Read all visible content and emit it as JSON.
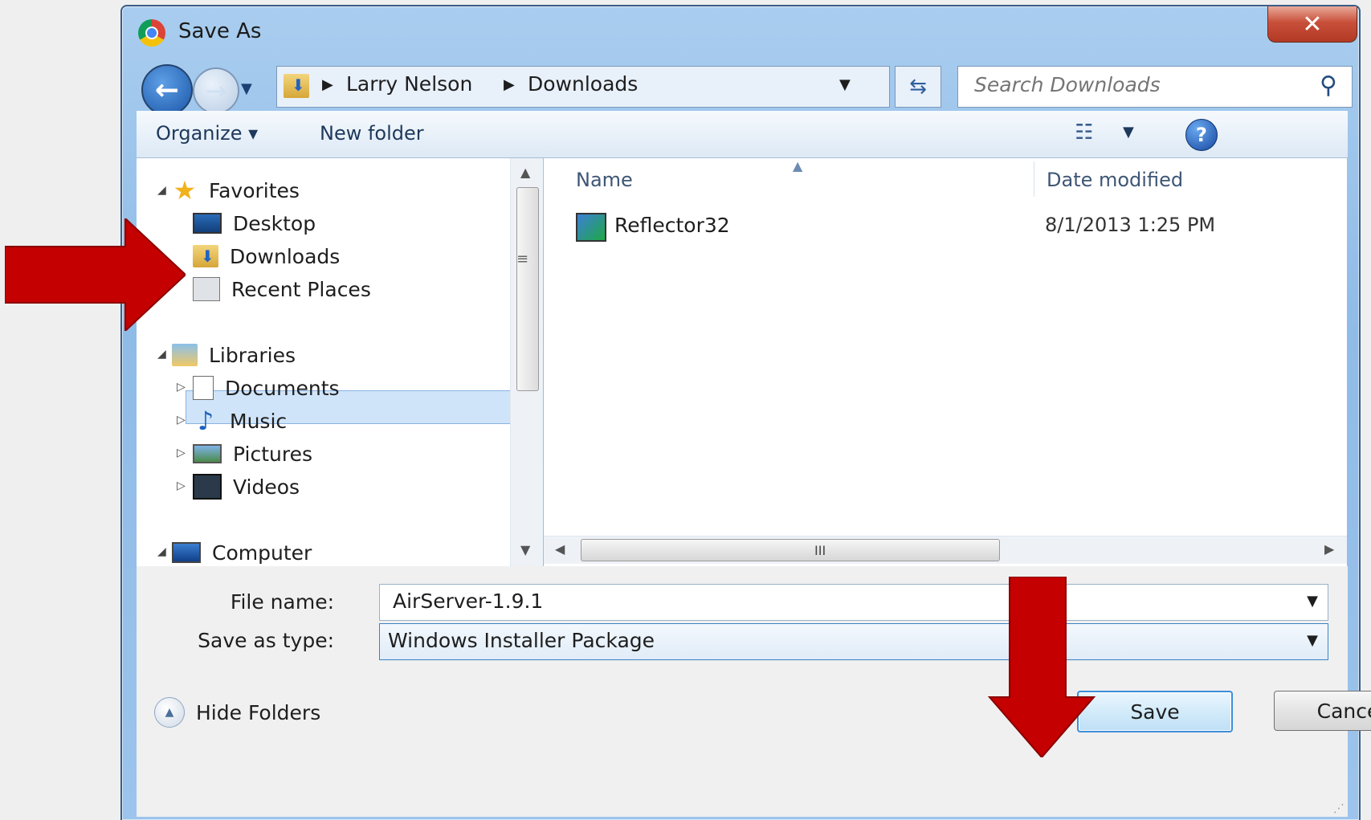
{
  "window": {
    "title": "Save As",
    "close_label": "✕"
  },
  "nav": {
    "back_label": "←",
    "forward_label": "→",
    "history_dropdown": "▼",
    "breadcrumbs": [
      "Larry Nelson",
      "Downloads"
    ],
    "crumb_separator": "▶",
    "address_dropdown": "▼",
    "refresh_label": "⇆",
    "search_placeholder": "Search Downloads",
    "search_icon": "⚲"
  },
  "toolbar": {
    "organize_label": "Organize ▾",
    "new_folder_label": "New folder",
    "view_icon": "☷",
    "view_dropdown": "▼",
    "help_label": "?"
  },
  "sidebar": {
    "favorites": {
      "label": "Favorites",
      "items": [
        "Desktop",
        "Downloads",
        "Recent Places"
      ]
    },
    "libraries": {
      "label": "Libraries",
      "items": [
        "Documents",
        "Music",
        "Pictures",
        "Videos"
      ]
    },
    "computer": {
      "label": "Computer"
    },
    "expanded_toggle": "◢",
    "collapsed_toggle": "▷"
  },
  "file_list": {
    "columns": [
      "Name",
      "Date modified"
    ],
    "sort_indicator": "▲",
    "files": [
      {
        "name": "Reflector32",
        "date_modified": "8/1/2013 1:25 PM"
      }
    ],
    "scroll_grip": "III"
  },
  "form": {
    "filename_label": "File name:",
    "filename_value": "AirServer-1.9.1",
    "type_label": "Save as type:",
    "type_value": "Windows Installer Package",
    "dropdown_glyph": "▼"
  },
  "footer": {
    "hide_folders_label": "Hide Folders",
    "save_label": "Save",
    "cancel_label": "Cancel"
  },
  "colors": {
    "annotation_arrow": "#c40000",
    "frame": "#9cc4ec",
    "selection": "#cfe4f9"
  }
}
